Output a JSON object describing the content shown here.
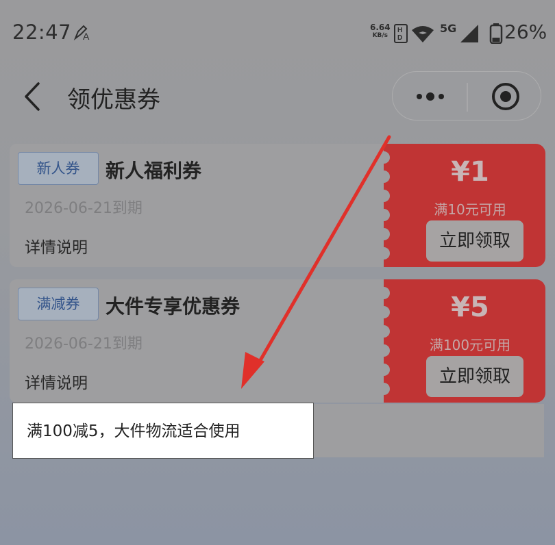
{
  "status_bar": {
    "time": "22:47",
    "net_speed_value": "6.64",
    "net_speed_unit": "KB/s",
    "hd_label": "HD",
    "network": "5G",
    "battery": "26%"
  },
  "nav": {
    "title": "领优惠券"
  },
  "coupons": [
    {
      "tag": "新人券",
      "name": "新人福利券",
      "expire": "2026-06-21到期",
      "detail": "详情说明",
      "price": "¥1",
      "condition": "满10元可用",
      "claim": "立即领取"
    },
    {
      "tag": "满减券",
      "name": "大件专享优惠券",
      "expire": "2026-06-21到期",
      "detail": "详情说明",
      "price": "¥5",
      "condition": "满100元可用",
      "claim": "立即领取"
    }
  ],
  "tooltip": {
    "text": "满100减5，大件物流适合使用"
  },
  "colors": {
    "coupon_red": "#c03434",
    "annotation_arrow": "#e0302a",
    "tag_blue": "#33548a"
  }
}
